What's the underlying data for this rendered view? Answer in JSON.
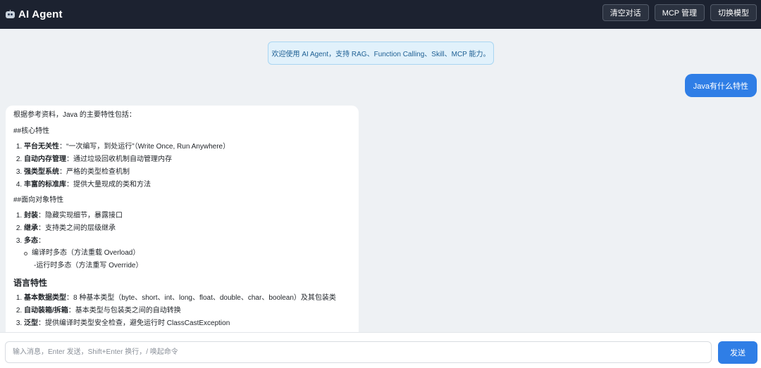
{
  "header": {
    "title": "AI Agent",
    "logo_icon": "robot-icon",
    "buttons": {
      "clear": "清空对话",
      "mcp": "MCP 管理",
      "switch_model": "切换模型"
    }
  },
  "chat": {
    "welcome": "欢迎使用 AI Agent，支持 RAG、Function Calling、Skill、MCP 能力。",
    "user_message": "Java有什么特性",
    "assistant": {
      "intro": "根据参考资料，Java 的主要特性包括：",
      "heading_core": "##核心特性",
      "core_items": [
        {
          "bold": "平台无关性",
          "text": "：“一次编写，到处运行”（Write Once, Run Anywhere）"
        },
        {
          "bold": "自动内存管理",
          "text": "：通过垃圾回收机制自动管理内存"
        },
        {
          "bold": "强类型系统",
          "text": "：严格的类型检查机制"
        },
        {
          "bold": "丰富的标准库",
          "text": "：提供大量现成的类和方法"
        }
      ],
      "heading_oop": "##面向对象特性",
      "oop_items": [
        {
          "bold": "封装",
          "text": "：隐藏实现细节，暴露接口"
        },
        {
          "bold": "继承",
          "text": "：支持类之间的层级继承"
        },
        {
          "bold": "多态",
          "text": "："
        }
      ],
      "poly_sub_circle": "编译时多态（方法重载 Overload）",
      "poly_sub_dash": "-运行时多态（方法重写 Override）",
      "heading_lang": "语言特性",
      "lang_items": [
        {
          "bold": "基本数据类型",
          "text": "：8 种基本类型（byte、short、int、long、float、double、char、boolean）及其包装类"
        },
        {
          "bold": "自动装箱/拆箱",
          "text": "：基本类型与包装类之间的自动转换"
        },
        {
          "bold": "泛型",
          "text": "：提供编译时类型安全检查，避免运行时 ClassCastException"
        }
      ]
    }
  },
  "input": {
    "placeholder": "输入消息，Enter 发送，Shift+Enter 换行，/ 唤起命令",
    "value": "",
    "send_label": "发送"
  },
  "colors": {
    "header_bg": "#1c2230",
    "accent": "#2f7ee6",
    "welcome_bg": "#e1f1fb"
  }
}
